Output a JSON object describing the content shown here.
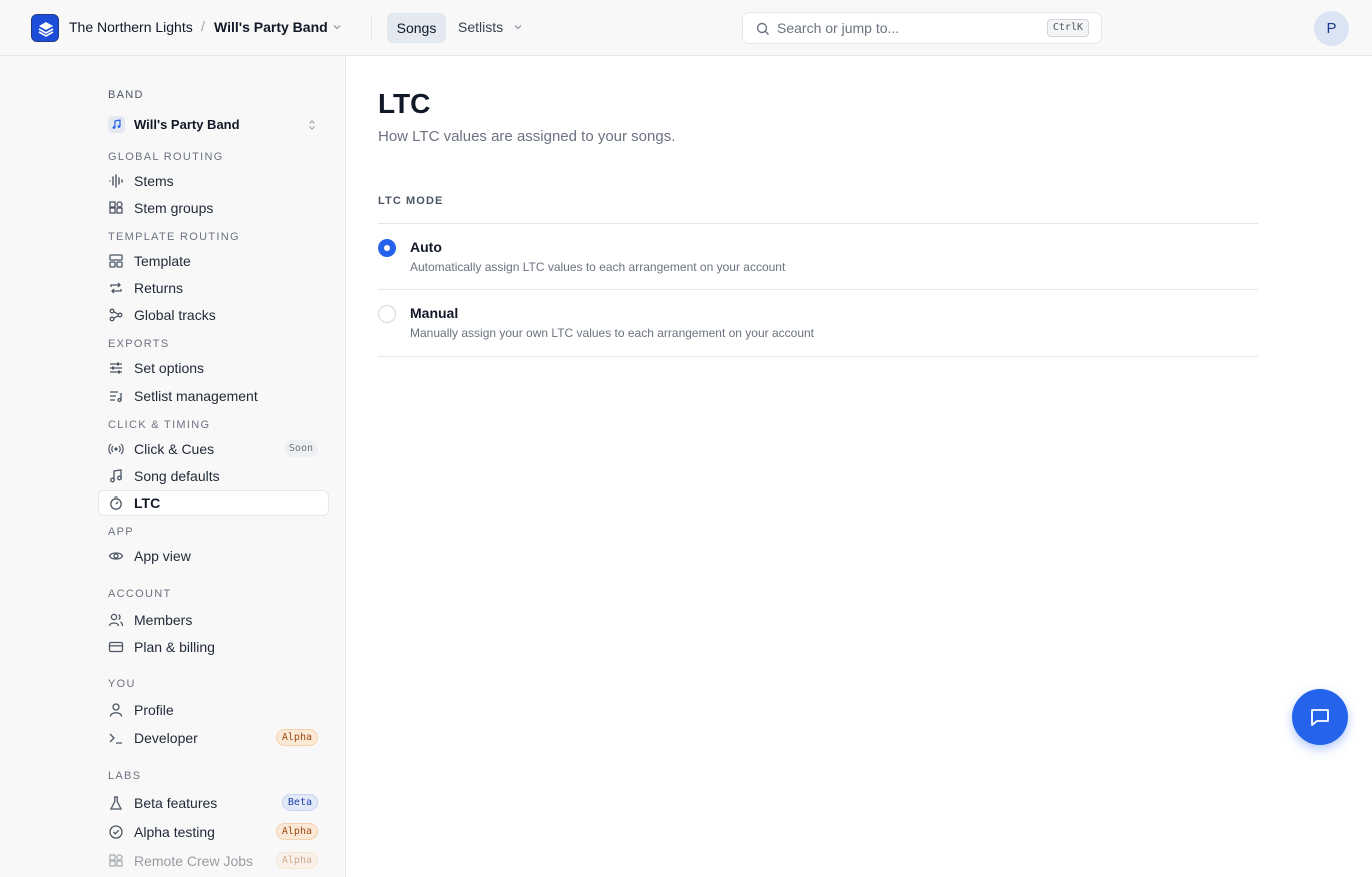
{
  "topbar": {
    "org_name": "The Northern Lights",
    "separator": "/",
    "band_name": "Will's Party Band",
    "nav_songs": "Songs",
    "nav_setlists": "Setlists",
    "search_placeholder": "Search or jump to...",
    "search_shortcut": "CtrlK",
    "avatar_initial": "P"
  },
  "sidebar": {
    "band_heading": "BAND",
    "band_select_label": "Will's Party Band",
    "sections": {
      "global_routing": "GLOBAL ROUTING",
      "template_routing": "TEMPLATE ROUTING",
      "exports": "EXPORTS",
      "click_timing": "CLICK & TIMING",
      "app": "APP",
      "account": "ACCOUNT",
      "you": "YOU",
      "labs": "LABS"
    },
    "items": {
      "stems": "Stems",
      "stem_groups": "Stem groups",
      "template": "Template",
      "returns": "Returns",
      "global_tracks": "Global tracks",
      "set_options": "Set options",
      "setlist_management": "Setlist management",
      "click_cues": "Click & Cues",
      "song_defaults": "Song defaults",
      "ltc": "LTC",
      "app_view": "App view",
      "members": "Members",
      "plan_billing": "Plan & billing",
      "profile": "Profile",
      "developer": "Developer",
      "beta_features": "Beta features",
      "alpha_testing": "Alpha testing",
      "remote_crew_jobs": "Remote Crew Jobs"
    },
    "badges": {
      "soon": "Soon",
      "alpha": "Alpha",
      "beta": "Beta"
    }
  },
  "main": {
    "title": "LTC",
    "subtitle": "How LTC values are assigned to your songs.",
    "mode_label": "LTC MODE",
    "options": [
      {
        "title": "Auto",
        "description": "Automatically assign LTC values to each arrangement on your account",
        "selected": true
      },
      {
        "title": "Manual",
        "description": "Manually assign your own LTC values to each arrangement on your account",
        "selected": false
      }
    ]
  },
  "colors": {
    "accent": "#2563eb",
    "sidebar_bg": "#f8f8f8",
    "alpha_badge_bg": "#fbe9d7",
    "beta_badge_bg": "#e2e8f6"
  },
  "icons": {
    "logo": "layers-logo-icon",
    "search": "search-icon",
    "chat": "chat-bubble-icon"
  }
}
